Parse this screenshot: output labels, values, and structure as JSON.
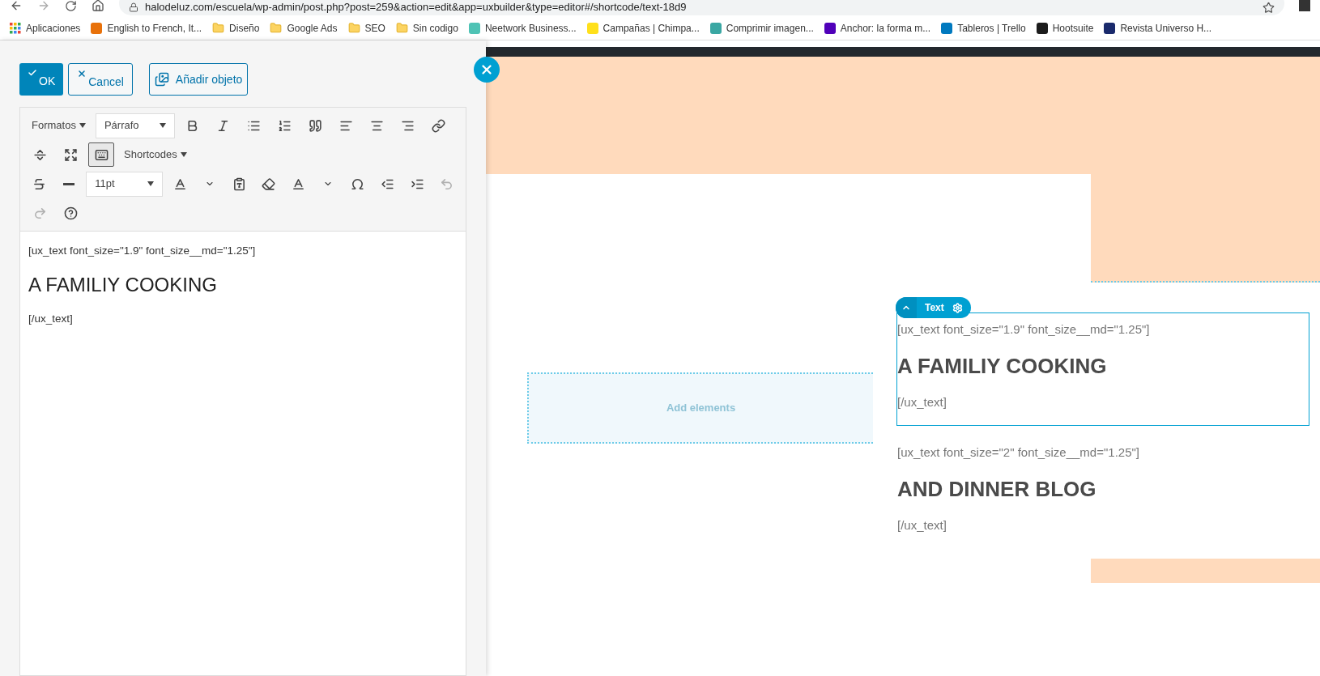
{
  "browser": {
    "url": "halodeluz.com/escuela/wp-admin/post.php?post=259&action=edit&app=uxbuilder&type=editor#/shortcode/text-18d9",
    "bookmarked": false,
    "bookmarks": [
      {
        "label": "Aplicaciones",
        "kind": "apps"
      },
      {
        "label": "English to French, It...",
        "kind": "site",
        "color": "#e8710a"
      },
      {
        "label": "Diseño",
        "kind": "folder"
      },
      {
        "label": "Google Ads",
        "kind": "folder"
      },
      {
        "label": "SEO",
        "kind": "folder"
      },
      {
        "label": "Sin codigo",
        "kind": "folder"
      },
      {
        "label": "Neetwork Business...",
        "kind": "site",
        "color": "#4fc3b5"
      },
      {
        "label": "Campañas | Chimpa...",
        "kind": "site",
        "color": "#ffe01b"
      },
      {
        "label": "Comprimir imagen...",
        "kind": "site",
        "color": "#3aa7a3"
      },
      {
        "label": "Anchor: la forma m...",
        "kind": "site",
        "color": "#5000b9"
      },
      {
        "label": "Tableros | Trello",
        "kind": "site",
        "color": "#0079bf"
      },
      {
        "label": "Hootsuite",
        "kind": "site",
        "color": "#1c1c1c"
      },
      {
        "label": "Revista Universo H...",
        "kind": "site",
        "color": "#1a2a6c"
      }
    ]
  },
  "editor": {
    "ok": "OK",
    "cancel": "Cancel",
    "add_object": "Añadir objeto",
    "toolbar": [
      [
        {
          "kind": "menu",
          "label": "Formatos"
        },
        {
          "kind": "select",
          "label": "Párrafo"
        },
        {
          "kind": "button",
          "pressed": false,
          "disabled": false
        },
        {
          "kind": "button",
          "pressed": false,
          "disabled": false
        },
        {
          "kind": "button",
          "pressed": false,
          "disabled": false
        },
        {
          "kind": "button",
          "pressed": false,
          "disabled": false
        },
        {
          "kind": "button",
          "pressed": false,
          "disabled": false
        },
        {
          "kind": "button",
          "pressed": false,
          "disabled": false
        },
        {
          "kind": "button",
          "pressed": false,
          "disabled": false
        },
        {
          "kind": "button",
          "pressed": false,
          "disabled": false
        },
        {
          "kind": "button",
          "pressed": false,
          "disabled": false
        }
      ],
      [
        {
          "kind": "button",
          "pressed": false,
          "disabled": false
        },
        {
          "kind": "button",
          "pressed": false,
          "disabled": false
        },
        {
          "kind": "button",
          "pressed": true,
          "disabled": false
        },
        {
          "kind": "menu",
          "label": "Shortcodes"
        }
      ],
      [
        {
          "kind": "button",
          "pressed": false,
          "disabled": false
        },
        {
          "kind": "button",
          "pressed": false,
          "disabled": false
        },
        {
          "kind": "select",
          "label": "11pt"
        },
        {
          "kind": "button",
          "pressed": false,
          "disabled": false
        },
        {
          "kind": "button",
          "pressed": false,
          "disabled": false
        },
        {
          "kind": "button",
          "pressed": false,
          "disabled": false
        },
        {
          "kind": "button",
          "pressed": false,
          "disabled": false
        },
        {
          "kind": "button",
          "pressed": false,
          "disabled": false
        },
        {
          "kind": "button",
          "pressed": false,
          "disabled": false
        },
        {
          "kind": "button",
          "pressed": false,
          "disabled": false
        },
        {
          "kind": "button",
          "pressed": false,
          "disabled": false
        },
        {
          "kind": "button",
          "pressed": false,
          "disabled": false
        },
        {
          "kind": "button",
          "pressed": false,
          "disabled": true
        }
      ],
      [
        {
          "kind": "button",
          "pressed": false,
          "disabled": true
        },
        {
          "kind": "button",
          "pressed": false,
          "disabled": false
        }
      ]
    ],
    "content": [
      {
        "kind": "code",
        "text": "[ux_text font_size=\"1.9\" font_size__md=\"1.25\"]"
      },
      {
        "kind": "heading",
        "text": "A FAMILIY COOKING"
      },
      {
        "kind": "code",
        "text": "[/ux_text]"
      }
    ]
  },
  "canvas": {
    "placeholder": "Add elements",
    "blocks": [
      {
        "selected": true,
        "tag": "Text",
        "lines": [
          {
            "kind": "code",
            "text": "[ux_text font_size=\"1.9\" font_size__md=\"1.25\"]"
          },
          {
            "kind": "heading",
            "text": "A FAMILIY COOKING"
          },
          {
            "kind": "code",
            "text": "[/ux_text]"
          }
        ]
      },
      {
        "selected": false,
        "lines": [
          {
            "kind": "code",
            "text": "[ux_text font_size=\"2\" font_size__md=\"1.25\"]"
          },
          {
            "kind": "heading",
            "text": "AND DINNER BLOG"
          },
          {
            "kind": "code",
            "text": "[/ux_text]"
          }
        ]
      }
    ]
  }
}
